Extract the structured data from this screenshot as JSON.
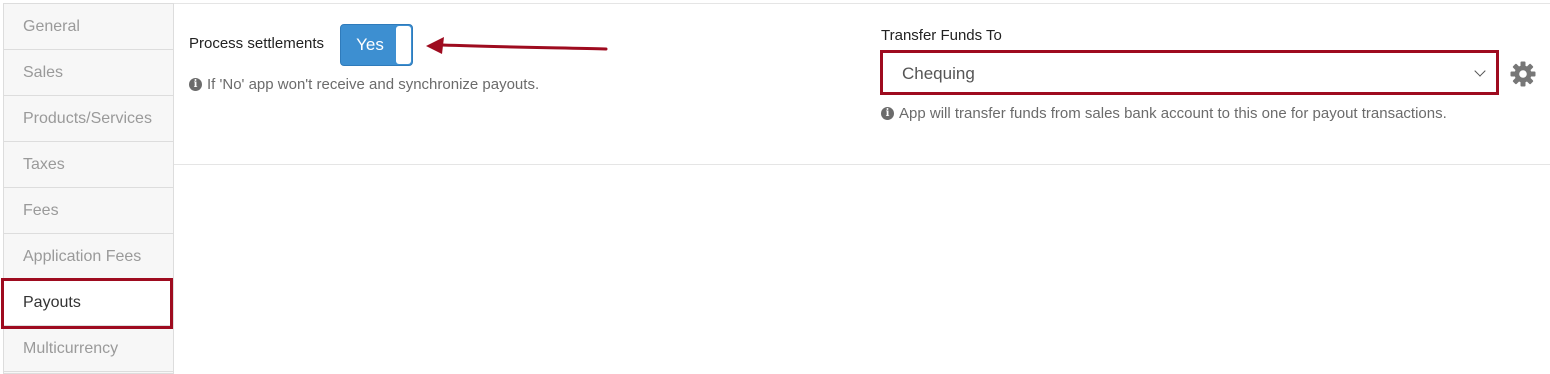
{
  "sidebar": {
    "items": [
      {
        "label": "General",
        "active": false
      },
      {
        "label": "Sales",
        "active": false
      },
      {
        "label": "Products/Services",
        "active": false
      },
      {
        "label": "Taxes",
        "active": false
      },
      {
        "label": "Fees",
        "active": false
      },
      {
        "label": "Application Fees",
        "active": false
      },
      {
        "label": "Payouts",
        "active": true
      },
      {
        "label": "Multicurrency",
        "active": false
      }
    ]
  },
  "settlements": {
    "label": "Process settlements",
    "toggle_value": "Yes",
    "help_text": "If 'No' app won't receive and synchronize payouts."
  },
  "transfer": {
    "label": "Transfer Funds To",
    "selected": "Chequing",
    "help_text": "App will transfer funds from sales bank account to this one for payout transactions."
  },
  "icons": {
    "info": "info-circle-icon",
    "gear": "gear-icon",
    "chevron": "chevron-down-icon",
    "annotation_arrow": "arrow-left-icon"
  },
  "colors": {
    "accent": "#3d8fd1",
    "highlight": "#9e0b1f"
  }
}
